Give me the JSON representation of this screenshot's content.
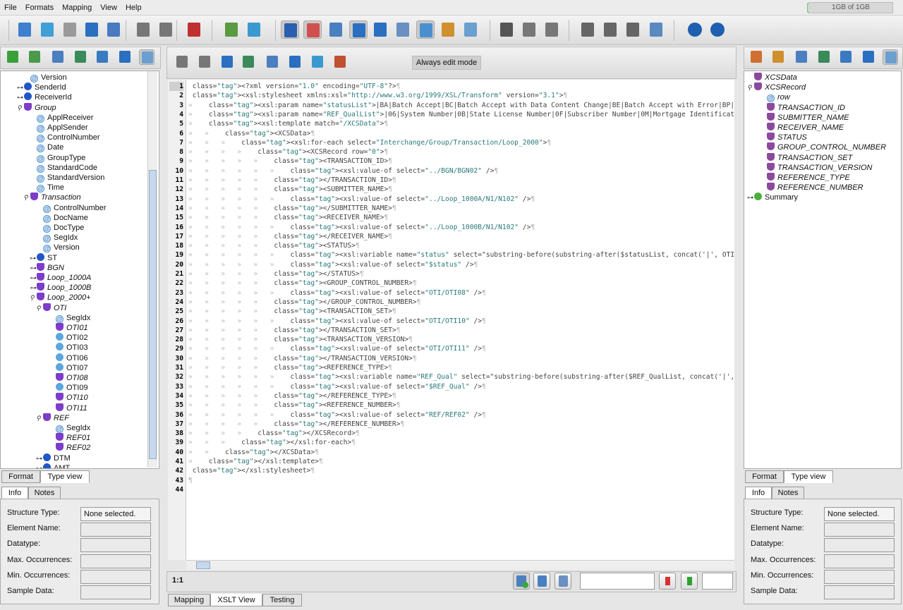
{
  "menu": [
    "File",
    "Formats",
    "Mapping",
    "View",
    "Help"
  ],
  "memory": "1GB of 1GB",
  "editor_toolbar": {
    "always_edit_label": "Always edit mode"
  },
  "left_tree": [
    {
      "indent": 2,
      "expander": "",
      "icon": "at",
      "label": "Version",
      "italic": false
    },
    {
      "indent": 1,
      "expander": "o-",
      "icon": "blue",
      "label": "SenderId",
      "italic": false
    },
    {
      "indent": 1,
      "expander": "o-",
      "icon": "blue",
      "label": "ReceiverId",
      "italic": false
    },
    {
      "indent": 1,
      "expander": "o|",
      "icon": "purple",
      "label": "Group",
      "italic": true
    },
    {
      "indent": 3,
      "expander": "",
      "icon": "at",
      "label": "ApplReceiver",
      "italic": false
    },
    {
      "indent": 3,
      "expander": "",
      "icon": "at",
      "label": "ApplSender",
      "italic": false
    },
    {
      "indent": 3,
      "expander": "",
      "icon": "at",
      "label": "ControlNumber",
      "italic": false
    },
    {
      "indent": 3,
      "expander": "",
      "icon": "at",
      "label": "Date",
      "italic": false
    },
    {
      "indent": 3,
      "expander": "",
      "icon": "at",
      "label": "GroupType",
      "italic": false
    },
    {
      "indent": 3,
      "expander": "",
      "icon": "at",
      "label": "StandardCode",
      "italic": false
    },
    {
      "indent": 3,
      "expander": "",
      "icon": "at",
      "label": "StandardVersion",
      "italic": false
    },
    {
      "indent": 3,
      "expander": "",
      "icon": "at",
      "label": "Time",
      "italic": false
    },
    {
      "indent": 2,
      "expander": "o|",
      "icon": "purple",
      "label": "Transaction",
      "italic": true
    },
    {
      "indent": 4,
      "expander": "",
      "icon": "at",
      "label": "ControlNumber",
      "italic": false
    },
    {
      "indent": 4,
      "expander": "",
      "icon": "at",
      "label": "DocName",
      "italic": false
    },
    {
      "indent": 4,
      "expander": "",
      "icon": "at",
      "label": "DocType",
      "italic": false
    },
    {
      "indent": 4,
      "expander": "",
      "icon": "at",
      "label": "SegIdx",
      "italic": false
    },
    {
      "indent": 4,
      "expander": "",
      "icon": "at",
      "label": "Version",
      "italic": false
    },
    {
      "indent": 3,
      "expander": "o-",
      "icon": "blue",
      "label": "ST",
      "italic": false
    },
    {
      "indent": 3,
      "expander": "o-",
      "icon": "purple",
      "label": "BGN",
      "italic": true
    },
    {
      "indent": 3,
      "expander": "o-",
      "icon": "purple",
      "label": "Loop_1000A",
      "italic": true
    },
    {
      "indent": 3,
      "expander": "o-",
      "icon": "purple",
      "label": "Loop_1000B",
      "italic": true
    },
    {
      "indent": 3,
      "expander": "o|",
      "icon": "purple",
      "label": "Loop_2000+",
      "italic": true
    },
    {
      "indent": 4,
      "expander": "o|",
      "icon": "purple",
      "label": "OTI",
      "italic": true
    },
    {
      "indent": 6,
      "expander": "",
      "icon": "at",
      "label": "SegIdx",
      "italic": false
    },
    {
      "indent": 6,
      "expander": "",
      "icon": "purple",
      "label": "OTI01",
      "italic": true
    },
    {
      "indent": 6,
      "expander": "",
      "icon": "light",
      "label": "OTI02",
      "italic": false
    },
    {
      "indent": 6,
      "expander": "",
      "icon": "light",
      "label": "OTI03",
      "italic": false
    },
    {
      "indent": 6,
      "expander": "",
      "icon": "light",
      "label": "OTI06",
      "italic": false
    },
    {
      "indent": 6,
      "expander": "",
      "icon": "light",
      "label": "OTI07",
      "italic": false
    },
    {
      "indent": 6,
      "expander": "",
      "icon": "purple",
      "label": "OTI08",
      "italic": true
    },
    {
      "indent": 6,
      "expander": "",
      "icon": "light",
      "label": "OTI09",
      "italic": false
    },
    {
      "indent": 6,
      "expander": "",
      "icon": "purple",
      "label": "OTI10",
      "italic": true
    },
    {
      "indent": 6,
      "expander": "",
      "icon": "purple",
      "label": "OTI11",
      "italic": true
    },
    {
      "indent": 4,
      "expander": "o|",
      "icon": "purple",
      "label": "REF",
      "italic": true
    },
    {
      "indent": 6,
      "expander": "",
      "icon": "at",
      "label": "SegIdx",
      "italic": false
    },
    {
      "indent": 6,
      "expander": "",
      "icon": "purple",
      "label": "REF01",
      "italic": true
    },
    {
      "indent": 6,
      "expander": "",
      "icon": "purple",
      "label": "REF02",
      "italic": true
    },
    {
      "indent": 4,
      "expander": "o-",
      "icon": "blue",
      "label": "DTM",
      "italic": false
    },
    {
      "indent": 4,
      "expander": "o-",
      "icon": "blue",
      "label": "AMT",
      "italic": false
    }
  ],
  "right_tree": [
    {
      "indent": 0,
      "expander": "",
      "icon": "rec",
      "label": "XCSData",
      "italic": true
    },
    {
      "indent": 0,
      "expander": "o|",
      "icon": "rec",
      "label": "XCSRecord",
      "italic": true
    },
    {
      "indent": 2,
      "expander": "",
      "icon": "at",
      "label": "row",
      "italic": true
    },
    {
      "indent": 2,
      "expander": "",
      "icon": "rec",
      "label": "TRANSACTION_ID",
      "italic": true
    },
    {
      "indent": 2,
      "expander": "",
      "icon": "rec",
      "label": "SUBMITTER_NAME",
      "italic": true
    },
    {
      "indent": 2,
      "expander": "",
      "icon": "rec",
      "label": "RECEIVER_NAME",
      "italic": true
    },
    {
      "indent": 2,
      "expander": "",
      "icon": "rec",
      "label": "STATUS",
      "italic": true
    },
    {
      "indent": 2,
      "expander": "",
      "icon": "rec",
      "label": "GROUP_CONTROL_NUMBER",
      "italic": true
    },
    {
      "indent": 2,
      "expander": "",
      "icon": "rec",
      "label": "TRANSACTION_SET",
      "italic": true
    },
    {
      "indent": 2,
      "expander": "",
      "icon": "rec",
      "label": "TRANSACTION_VERSION",
      "italic": true
    },
    {
      "indent": 2,
      "expander": "",
      "icon": "rec",
      "label": "REFERENCE_TYPE",
      "italic": true
    },
    {
      "indent": 2,
      "expander": "",
      "icon": "rec",
      "label": "REFERENCE_NUMBER",
      "italic": true
    },
    {
      "indent": 0,
      "expander": "o-",
      "icon": "green",
      "label": "Summary",
      "italic": false
    }
  ],
  "tree_tabs": {
    "format": "Format",
    "type_view": "Type view"
  },
  "info_tabs": {
    "info": "Info",
    "notes": "Notes"
  },
  "info_fields": [
    {
      "label": "Structure Type:",
      "value": "None selected."
    },
    {
      "label": "Element Name:",
      "value": ""
    },
    {
      "label": "Datatype:",
      "value": ""
    },
    {
      "label": "Max. Occurrences:",
      "value": ""
    },
    {
      "label": "Min. Occurrences:",
      "value": ""
    },
    {
      "label": "Sample Data:",
      "value": ""
    }
  ],
  "bottom_tabs": [
    "Mapping",
    "XSLT View",
    "Testing"
  ],
  "cursor_pos": "1:1",
  "code_lines": [
    [
      0,
      "<?xml version=\"1.0\" encoding=\"UTF-8\"?>"
    ],
    [
      0,
      "<xsl:stylesheet xmlns:xsl=\"http://www.w3.org/1999/XSL/Transform\" version=\"3.1\">"
    ],
    [
      1,
      "<xsl:param name=\"statusList\">|BA|Batch Accept|BC|Batch Accept with Data Content Change|BE|Batch Accept with Error|BP|Batc"
    ],
    [
      1,
      "<xsl:param name=\"REF_QualList\">|06|System Number|0B|State License Number|0F|Subscriber Number|0M|Mortgage Identification"
    ],
    [
      1,
      "<xsl:template match=\"/XCSData\">"
    ],
    [
      2,
      "<XCSData>"
    ],
    [
      3,
      "<xsl:for-each select=\"Interchange/Group/Transaction/Loop_2000\">"
    ],
    [
      4,
      "<XCSRecord row=\"0\">"
    ],
    [
      5,
      "<TRANSACTION_ID>"
    ],
    [
      6,
      "<xsl:value-of select=\"../BGN/BGN02\" />"
    ],
    [
      5,
      "</TRANSACTION_ID>"
    ],
    [
      5,
      "<SUBMITTER_NAME>"
    ],
    [
      6,
      "<xsl:value-of select=\"../Loop_1000A/N1/N102\" />"
    ],
    [
      5,
      "</SUBMITTER_NAME>"
    ],
    [
      5,
      "<RECEIVER_NAME>"
    ],
    [
      6,
      "<xsl:value-of select=\"../Loop_1000B/N1/N102\" />"
    ],
    [
      5,
      "</RECEIVER_NAME>"
    ],
    [
      5,
      "<STATUS>"
    ],
    [
      6,
      "<xsl:variable name=\"status\" select=\"substring-before(substring-after($statusList, concat('|', OTI/OTI"
    ],
    [
      6,
      "<xsl:value-of select=\"$status\" />"
    ],
    [
      5,
      "</STATUS>"
    ],
    [
      5,
      "<GROUP_CONTROL_NUMBER>"
    ],
    [
      6,
      "<xsl:value-of select=\"OTI/OTI08\" />"
    ],
    [
      5,
      "</GROUP_CONTROL_NUMBER>"
    ],
    [
      5,
      "<TRANSACTION_SET>"
    ],
    [
      6,
      "<xsl:value-of select=\"OTI/OTI10\" />"
    ],
    [
      5,
      "</TRANSACTION_SET>"
    ],
    [
      5,
      "<TRANSACTION_VERSION>"
    ],
    [
      6,
      "<xsl:value-of select=\"OTI/OTI11\" />"
    ],
    [
      5,
      "</TRANSACTION_VERSION>"
    ],
    [
      5,
      "<REFERENCE_TYPE>"
    ],
    [
      6,
      "<xsl:variable name=\"REF_Qual\" select=\"substring-before(substring-after($REF_QualList, concat('|', REF"
    ],
    [
      6,
      "<xsl:value-of select=\"$REF_Qual\" />"
    ],
    [
      5,
      "</REFERENCE_TYPE>"
    ],
    [
      5,
      "<REFERENCE_NUMBER>"
    ],
    [
      6,
      "<xsl:value-of select=\"REF/REF02\" />"
    ],
    [
      5,
      "</REFERENCE_NUMBER>"
    ],
    [
      4,
      "</XCSRecord>"
    ],
    [
      3,
      "</xsl:for-each>"
    ],
    [
      2,
      "</XCSData>"
    ],
    [
      1,
      "</xsl:template>"
    ],
    [
      0,
      "</xsl:stylesheet>"
    ],
    [
      0,
      ""
    ],
    [
      0,
      ""
    ]
  ]
}
